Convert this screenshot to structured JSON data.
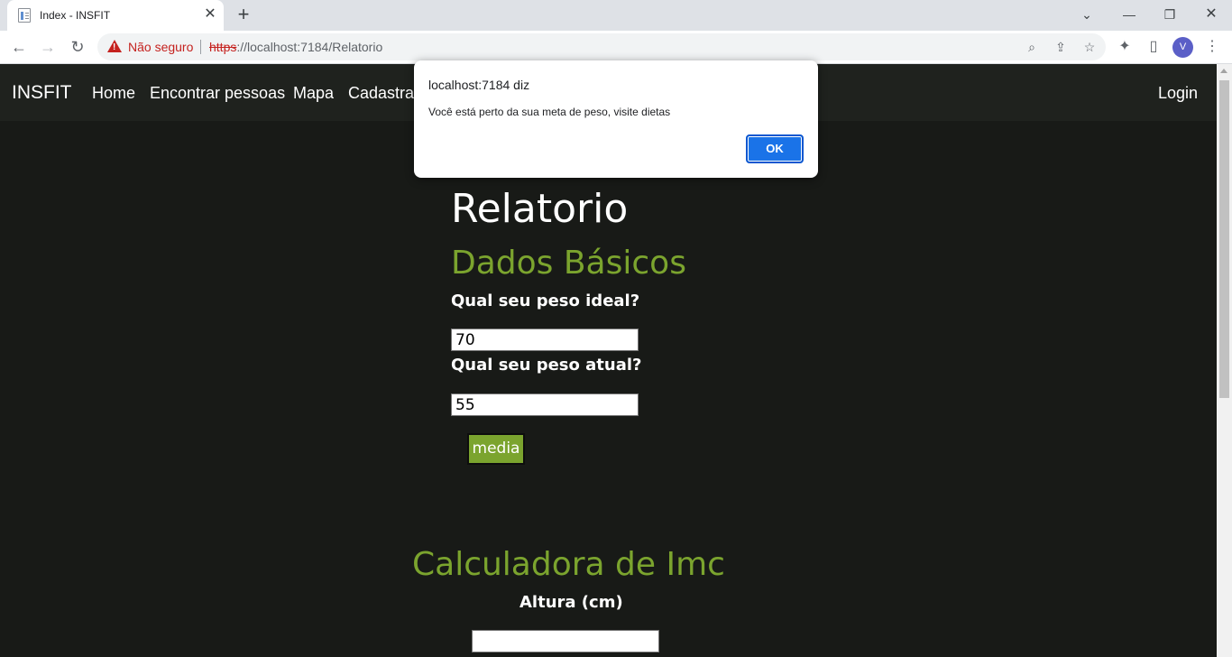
{
  "browser": {
    "tab_title": "Index - INSFIT",
    "new_tab_symbol": "+",
    "security_label": "Não seguro",
    "url_scheme": "https",
    "url_rest": "://localhost:7184/Relatorio",
    "profile_initial": "V",
    "icons": [
      "back-icon",
      "forward-icon",
      "reload-icon",
      "zoom-icon",
      "share-icon",
      "bookmark-star-icon",
      "extensions-icon",
      "side-panel-icon",
      "menu-icon"
    ]
  },
  "site": {
    "brand": "INSFIT",
    "nav": {
      "home": "Home",
      "find_people": "Encontrar pessoas",
      "map": "Mapa",
      "register": "Cadastrar",
      "login": "Login"
    }
  },
  "page": {
    "title": "Relatorio",
    "basic_section": {
      "heading": "Dados Básicos",
      "ideal_weight_label": "Qual seu peso ideal?",
      "ideal_weight_value": "70",
      "current_weight_label": "Qual seu peso atual?",
      "current_weight_value": "55",
      "media_button": "media"
    },
    "imc_section": {
      "heading": "Calculadora de Imc",
      "height_label": "Altura (cm)",
      "height_value": ""
    }
  },
  "alert": {
    "origin": "localhost:7184 diz",
    "message": "Você está perto da sua meta de peso, visite dietas",
    "ok_label": "OK"
  },
  "colors": {
    "page_background": "#181a17",
    "navbar_background": "#1f221e",
    "accent_green": "#7ba42e",
    "dialog_button_blue": "#1a73e8"
  }
}
